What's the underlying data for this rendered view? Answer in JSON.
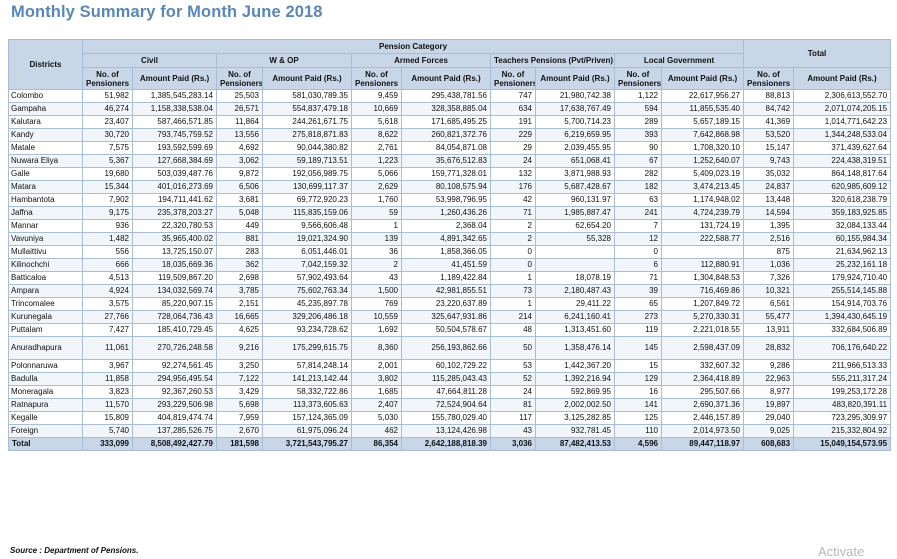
{
  "title": "Monthly Summary for Month June 2018",
  "headers": {
    "districts": "Districts",
    "pension_category": "Pension Category",
    "total": "Total",
    "categories": [
      "Civil",
      "W & OP",
      "Armed Forces",
      "Teachers Pensions (Pvt/Priven)",
      "Local Government"
    ],
    "no_of_pensioners": "No. of Pensioners",
    "amount_paid": "Amount Paid (Rs.)"
  },
  "rows": [
    {
      "district": "Colombo",
      "civil_n": "51,982",
      "civil_a": "1,385,545,283.14",
      "wop_n": "25,503",
      "wop_a": "581,030,789.35",
      "af_n": "9,459",
      "af_a": "295,438,781.56",
      "tp_n": "747",
      "tp_a": "21,980,742.38",
      "lg_n": "1,122",
      "lg_a": "22,617,956.27",
      "tot_n": "88,813",
      "tot_a": "2,306,613,552.70"
    },
    {
      "district": "Gampaha",
      "civil_n": "46,274",
      "civil_a": "1,158,338,538.04",
      "wop_n": "26,571",
      "wop_a": "554,837,479.18",
      "af_n": "10,669",
      "af_a": "328,358,885.04",
      "tp_n": "634",
      "tp_a": "17,638,767.49",
      "lg_n": "594",
      "lg_a": "11,855,535.40",
      "tot_n": "84,742",
      "tot_a": "2,071,074,205.15"
    },
    {
      "district": "Kalutara",
      "civil_n": "23,407",
      "civil_a": "587,466,571.85",
      "wop_n": "11,864",
      "wop_a": "244,261,671.75",
      "af_n": "5,618",
      "af_a": "171,685,495.25",
      "tp_n": "191",
      "tp_a": "5,700,714.23",
      "lg_n": "289",
      "lg_a": "5,657,189.15",
      "tot_n": "41,369",
      "tot_a": "1,014,771,642.23"
    },
    {
      "district": "Kandy",
      "civil_n": "30,720",
      "civil_a": "793,745,759.52",
      "wop_n": "13,556",
      "wop_a": "275,818,871.83",
      "af_n": "8,622",
      "af_a": "260,821,372.76",
      "tp_n": "229",
      "tp_a": "6,219,659.95",
      "lg_n": "393",
      "lg_a": "7,642,868.98",
      "tot_n": "53,520",
      "tot_a": "1,344,248,533.04"
    },
    {
      "district": "Matale",
      "civil_n": "7,575",
      "civil_a": "193,592,599.69",
      "wop_n": "4,692",
      "wop_a": "90,044,380.82",
      "af_n": "2,761",
      "af_a": "84,054,871.08",
      "tp_n": "29",
      "tp_a": "2,039,455.95",
      "lg_n": "90",
      "lg_a": "1,708,320.10",
      "tot_n": "15,147",
      "tot_a": "371,439,627.64"
    },
    {
      "district": "Nuwara Eliya",
      "civil_n": "5,367",
      "civil_a": "127,668,384.69",
      "wop_n": "3,062",
      "wop_a": "59,189,713.51",
      "af_n": "1,223",
      "af_a": "35,676,512.83",
      "tp_n": "24",
      "tp_a": "651,068.41",
      "lg_n": "67",
      "lg_a": "1,252,640.07",
      "tot_n": "9,743",
      "tot_a": "224,438,319.51"
    },
    {
      "district": "Galle",
      "civil_n": "19,680",
      "civil_a": "503,039,487.76",
      "wop_n": "9,872",
      "wop_a": "192,056,989.75",
      "af_n": "5,066",
      "af_a": "159,771,328.01",
      "tp_n": "132",
      "tp_a": "3,871,988.93",
      "lg_n": "282",
      "lg_a": "5,409,023.19",
      "tot_n": "35,032",
      "tot_a": "864,148,817.64"
    },
    {
      "district": "Matara",
      "civil_n": "15,344",
      "civil_a": "401,016,273.69",
      "wop_n": "6,506",
      "wop_a": "130,699,117.37",
      "af_n": "2,629",
      "af_a": "80,108,575.94",
      "tp_n": "176",
      "tp_a": "5,687,428.67",
      "lg_n": "182",
      "lg_a": "3,474,213.45",
      "tot_n": "24,837",
      "tot_a": "620,985,609.12"
    },
    {
      "district": "Hambantota",
      "civil_n": "7,902",
      "civil_a": "194,711,441.62",
      "wop_n": "3,681",
      "wop_a": "69,772,920.23",
      "af_n": "1,760",
      "af_a": "53,998,796.95",
      "tp_n": "42",
      "tp_a": "960,131.97",
      "lg_n": "63",
      "lg_a": "1,174,948.02",
      "tot_n": "13,448",
      "tot_a": "320,618,238.79"
    },
    {
      "district": "Jaffna",
      "civil_n": "9,175",
      "civil_a": "235,378,203.27",
      "wop_n": "5,048",
      "wop_a": "115,835,159.06",
      "af_n": "59",
      "af_a": "1,260,436.26",
      "tp_n": "71",
      "tp_a": "1,985,887.47",
      "lg_n": "241",
      "lg_a": "4,724,239.79",
      "tot_n": "14,594",
      "tot_a": "359,183,925.85"
    },
    {
      "district": "Mannar",
      "civil_n": "936",
      "civil_a": "22,320,780.53",
      "wop_n": "449",
      "wop_a": "9,566,606.48",
      "af_n": "1",
      "af_a": "2,368.04",
      "tp_n": "2",
      "tp_a": "62,654.20",
      "lg_n": "7",
      "lg_a": "131,724.19",
      "tot_n": "1,395",
      "tot_a": "32,084,133.44"
    },
    {
      "district": "Vavuniya",
      "civil_n": "1,482",
      "civil_a": "35,965,400.02",
      "wop_n": "881",
      "wop_a": "19,021,324.90",
      "af_n": "139",
      "af_a": "4,891,342.65",
      "tp_n": "2",
      "tp_a": "55,328",
      "lg_n": "12",
      "lg_a": "222,588.77",
      "tot_n": "2,516",
      "tot_a": "60,155,984.34"
    },
    {
      "district": "Mullaittivu",
      "civil_n": "556",
      "civil_a": "13,725,150.07",
      "wop_n": "283",
      "wop_a": "6,051,446.01",
      "af_n": "36",
      "af_a": "1,858,366.05",
      "tp_n": "0",
      "tp_a": "",
      "lg_n": "0",
      "lg_a": "",
      "tot_n": "875",
      "tot_a": "21,634,962.13"
    },
    {
      "district": "Kilinochchi",
      "civil_n": "666",
      "civil_a": "18,035,669.36",
      "wop_n": "362",
      "wop_a": "7,042,159.32",
      "af_n": "2",
      "af_a": "41,451.59",
      "tp_n": "0",
      "tp_a": "",
      "lg_n": "6",
      "lg_a": "112,880.91",
      "tot_n": "1,036",
      "tot_a": "25,232,161.18"
    },
    {
      "district": "Batticaloa",
      "civil_n": "4,513",
      "civil_a": "119,509,867.20",
      "wop_n": "2,698",
      "wop_a": "57,902,493.64",
      "af_n": "43",
      "af_a": "1,189,422.84",
      "tp_n": "1",
      "tp_a": "18,078.19",
      "lg_n": "71",
      "lg_a": "1,304,848.53",
      "tot_n": "7,326",
      "tot_a": "179,924,710.40"
    },
    {
      "district": "Ampara",
      "civil_n": "4,924",
      "civil_a": "134,032,569.74",
      "wop_n": "3,785",
      "wop_a": "75,602,763.34",
      "af_n": "1,500",
      "af_a": "42,981,855.51",
      "tp_n": "73",
      "tp_a": "2,180,487.43",
      "lg_n": "39",
      "lg_a": "716,469.86",
      "tot_n": "10,321",
      "tot_a": "255,514,145.88"
    },
    {
      "district": "Trincomalee",
      "civil_n": "3,575",
      "civil_a": "85,220,907.15",
      "wop_n": "2,151",
      "wop_a": "45,235,897.78",
      "af_n": "769",
      "af_a": "23,220,637.89",
      "tp_n": "1",
      "tp_a": "29,411.22",
      "lg_n": "65",
      "lg_a": "1,207,849.72",
      "tot_n": "6,561",
      "tot_a": "154,914,703.76"
    },
    {
      "district": "Kurunegala",
      "civil_n": "27,766",
      "civil_a": "728,064,736.43",
      "wop_n": "16,665",
      "wop_a": "329,206,486.18",
      "af_n": "10,559",
      "af_a": "325,647,931.86",
      "tp_n": "214",
      "tp_a": "6,241,160.41",
      "lg_n": "273",
      "lg_a": "5,270,330.31",
      "tot_n": "55,477",
      "tot_a": "1,394,430,645.19"
    },
    {
      "district": "Puttalam",
      "civil_n": "7,427",
      "civil_a": "185,410,729.45",
      "wop_n": "4,625",
      "wop_a": "93,234,728.62",
      "af_n": "1,692",
      "af_a": "50,504,578.67",
      "tp_n": "48",
      "tp_a": "1,313,451.60",
      "lg_n": "119",
      "lg_a": "2,221,018.55",
      "tot_n": "13,911",
      "tot_a": "332,684,506.89"
    },
    {
      "district": "Anuradhapura",
      "civil_n": "11,061",
      "civil_a": "270,726,248.58",
      "wop_n": "9,216",
      "wop_a": "175,299,615.75",
      "af_n": "8,360",
      "af_a": "256,193,862.66",
      "tp_n": "50",
      "tp_a": "1,358,476.14",
      "lg_n": "145",
      "lg_a": "2,598,437.09",
      "tot_n": "28,832",
      "tot_a": "706,176,640.22",
      "tall": true
    },
    {
      "district": "Polonnaruwa",
      "civil_n": "3,967",
      "civil_a": "92,274,561.45",
      "wop_n": "3,250",
      "wop_a": "57,814,248.14",
      "af_n": "2,001",
      "af_a": "60,102,729.22",
      "tp_n": "53",
      "tp_a": "1,442,367.20",
      "lg_n": "15",
      "lg_a": "332,607.32",
      "tot_n": "9,286",
      "tot_a": "211,966,513.33"
    },
    {
      "district": "Badulla",
      "civil_n": "11,858",
      "civil_a": "294,956,495.54",
      "wop_n": "7,122",
      "wop_a": "141,213,142.44",
      "af_n": "3,802",
      "af_a": "115,285,043.43",
      "tp_n": "52",
      "tp_a": "1,392,216.94",
      "lg_n": "129",
      "lg_a": "2,364,418.89",
      "tot_n": "22,963",
      "tot_a": "555,211,317.24"
    },
    {
      "district": "Moneragala",
      "civil_n": "3,823",
      "civil_a": "92,367,260.53",
      "wop_n": "3,429",
      "wop_a": "58,332,722.86",
      "af_n": "1,685",
      "af_a": "47,664,811.28",
      "tp_n": "24",
      "tp_a": "592,869.95",
      "lg_n": "16",
      "lg_a": "295,507.66",
      "tot_n": "8,977",
      "tot_a": "199,253,172.28"
    },
    {
      "district": "Ratnapura",
      "civil_n": "11,570",
      "civil_a": "293,229,506.98",
      "wop_n": "5,698",
      "wop_a": "113,373,605.63",
      "af_n": "2,407",
      "af_a": "72,524,904.64",
      "tp_n": "81",
      "tp_a": "2,002,002.50",
      "lg_n": "141",
      "lg_a": "2,690,371.36",
      "tot_n": "19,897",
      "tot_a": "483,820,391.11"
    },
    {
      "district": "Kegalle",
      "civil_n": "15,809",
      "civil_a": "404,819,474.74",
      "wop_n": "7,959",
      "wop_a": "157,124,365.09",
      "af_n": "5,030",
      "af_a": "155,780,029.40",
      "tp_n": "117",
      "tp_a": "3,125,282.85",
      "lg_n": "125",
      "lg_a": "2,446,157.89",
      "tot_n": "29,040",
      "tot_a": "723,295,309.97"
    },
    {
      "district": "Foreign",
      "civil_n": "5,740",
      "civil_a": "137,285,526.75",
      "wop_n": "2,670",
      "wop_a": "61,975,096.24",
      "af_n": "462",
      "af_a": "13,124,426.98",
      "tp_n": "43",
      "tp_a": "932,781.45",
      "lg_n": "110",
      "lg_a": "2,014,973.50",
      "tot_n": "9,025",
      "tot_a": "215,332,804.92"
    }
  ],
  "total_row": {
    "district": "Total",
    "civil_n": "333,099",
    "civil_a": "8,508,492,427.79",
    "wop_n": "181,598",
    "wop_a": "3,721,543,795.27",
    "af_n": "86,354",
    "af_a": "2,642,188,818.39",
    "tp_n": "3,036",
    "tp_a": "87,482,413.53",
    "lg_n": "4,596",
    "lg_a": "89,447,118.97",
    "tot_n": "608,683",
    "tot_a": "15,049,154,573.95"
  },
  "source": "Source : Department of Pensions.",
  "watermark": "Activate"
}
